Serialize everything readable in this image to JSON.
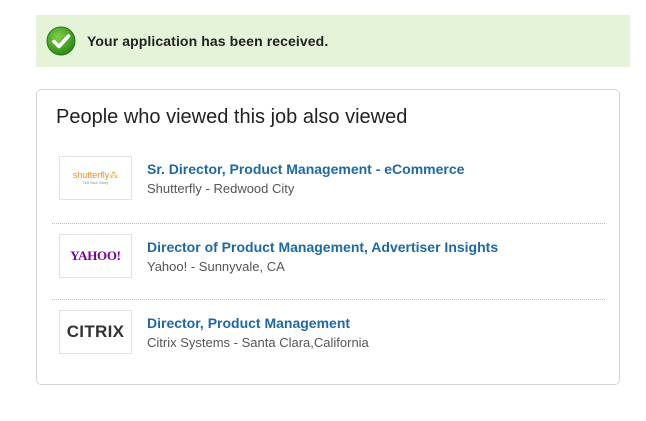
{
  "banner": {
    "message": "Your application has been received.",
    "icon": "check-circle-icon",
    "background": "#e5f3d9",
    "icon_color": "#3d9a1f"
  },
  "also_viewed": {
    "title": "People who viewed this job also viewed",
    "jobs": [
      {
        "title": "Sr. Director, Product Management - eCommerce",
        "company_location": "Shutterfly - Redwood City",
        "logo_text": "shutterfly",
        "logo_sub": "Tell Your Story"
      },
      {
        "title": "Director of Product Management, Advertiser Insights",
        "company_location": "Yahoo! - Sunnyvale, CA",
        "logo_text": "YAHOO!"
      },
      {
        "title": "Director, Product Management",
        "company_location": "Citrix Systems - Santa Clara,California",
        "logo_text": "CITRIX"
      }
    ]
  },
  "colors": {
    "link": "#1d69a6",
    "meta_text": "#555555",
    "border": "#d6d6d6"
  }
}
